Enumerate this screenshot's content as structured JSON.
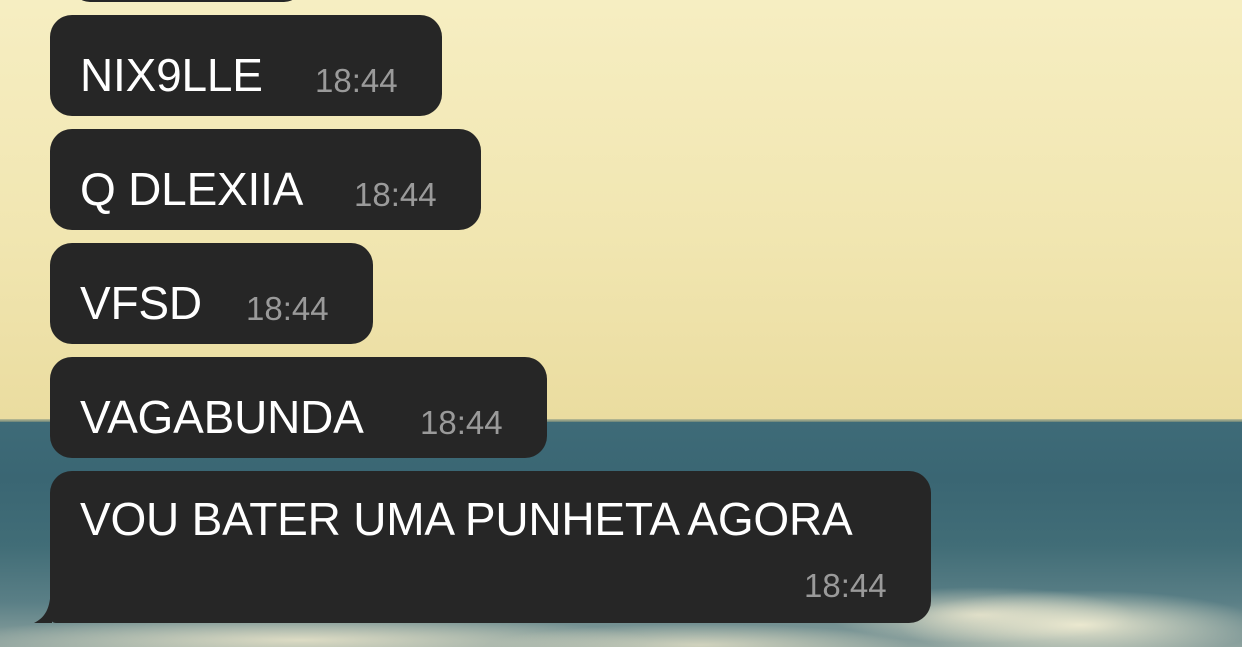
{
  "conversation": {
    "messages": [
      {
        "text": "NIX9LLE",
        "time": "18:44"
      },
      {
        "text": "Q DLEXIIA",
        "time": "18:44"
      },
      {
        "text": "VFSD",
        "time": "18:44"
      },
      {
        "text": "VAGABUNDA",
        "time": "18:44"
      },
      {
        "text": "VOU BATER UMA PUNHETA AGORA",
        "time": "18:44"
      }
    ]
  },
  "colors": {
    "bubble": "#262626",
    "message_text": "#ffffff",
    "timestamp": "#9a9a9a",
    "sky": "#f1e6b1",
    "sea": "#3e6b78"
  }
}
